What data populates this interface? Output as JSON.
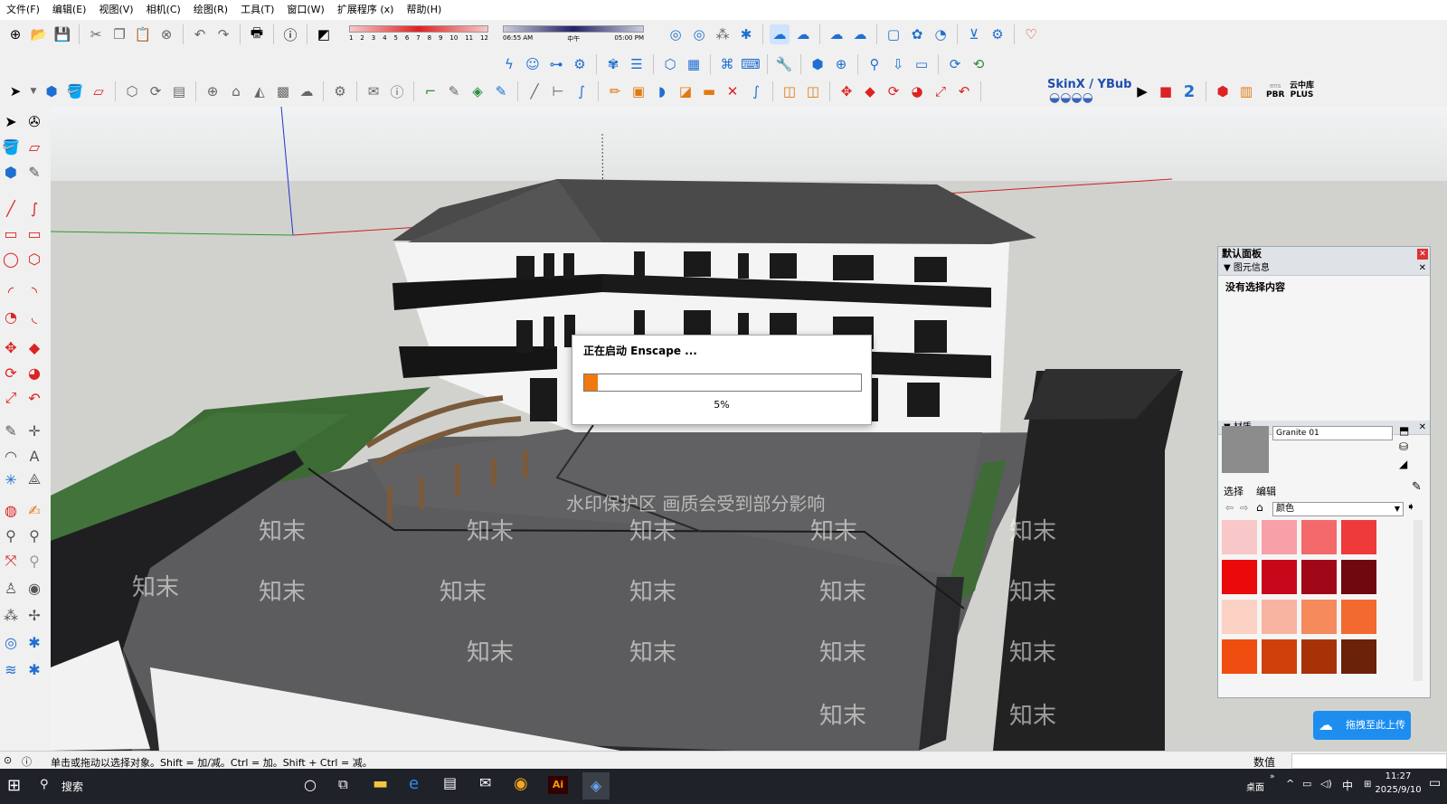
{
  "menubar": {
    "items": [
      "文件(F)",
      "编辑(E)",
      "视图(V)",
      "相机(C)",
      "绘图(R)",
      "工具(T)",
      "窗口(W)",
      "扩展程序 (x)",
      "帮助(H)"
    ]
  },
  "toolbar": {
    "shadow_hours": [
      "1",
      "2",
      "3",
      "4",
      "5",
      "6",
      "7",
      "8",
      "9",
      "10",
      "11",
      "12"
    ],
    "time_start": "06:55 AM",
    "time_mid": "中午",
    "time_end": "05:00 PM",
    "skinx_label": "SkinX / YBub",
    "pbr_label": "PBR",
    "plus_top": "云中库",
    "plus_label": "PLUS"
  },
  "dialog": {
    "title": "正在启动 Enscape ...",
    "percent_text": "5%",
    "progress": 0.05
  },
  "watermark": {
    "main": "水印保护区   画质会受到部分影响",
    "brand": "知末"
  },
  "panel": {
    "title": "默认面板",
    "entity_section": "图元信息",
    "entity_empty": "没有选择内容",
    "material_section": "材质",
    "material_name": "Granite 01",
    "tab_select": "选择",
    "tab_edit": "编辑",
    "library_value": "颜色",
    "swatches": [
      "#f8c8c8",
      "#f8a0a8",
      "#f46a6a",
      "#ee3a3a",
      "#ea0a0a",
      "#c8081a",
      "#a00818",
      "#700810",
      "#fbd2c4",
      "#f8b4a0",
      "#f58a5c",
      "#f26a30",
      "#f04e10",
      "#d0400a",
      "#a83208",
      "#6a2208"
    ]
  },
  "upload": {
    "label": "拖拽至此上传"
  },
  "statusbar": {
    "hint": "单击或拖动以选择对象。Shift = 加/减。Ctrl = 加。Shift + Ctrl = 减。",
    "measure_label": "数值"
  },
  "taskbar": {
    "search": "搜索",
    "desktop": "桌面",
    "ime": "中",
    "time": "11:27",
    "date": "2025/9/10"
  },
  "colors": {
    "accent": "#1f6fd1",
    "progress_fill": "#f07a10",
    "roof": "#4a4a4a",
    "lawn": "#3c6b33",
    "pavement": "#5c5c5e"
  }
}
